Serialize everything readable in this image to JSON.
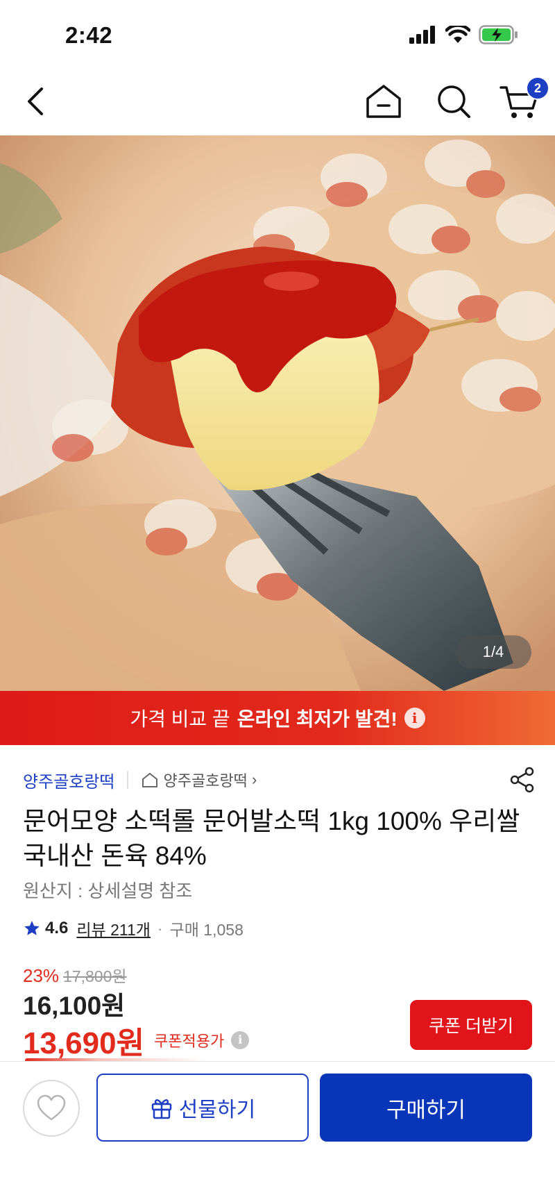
{
  "status_bar": {
    "time": "2:42",
    "icons": [
      "signal-icon",
      "wifi-icon",
      "battery-charging-icon"
    ]
  },
  "nav": {
    "icons": [
      "back-icon",
      "home-icon",
      "search-icon",
      "cart-icon"
    ],
    "cart_count": "2"
  },
  "product_image": {
    "counter": "1/4"
  },
  "promo_banner": {
    "text_regular": "가격 비교 끝",
    "text_bold": "온라인 최저가 발견!",
    "info_icon": "i"
  },
  "seller": {
    "name": "양주골호랑떡",
    "store_link": "양주골호랑떡",
    "store_chevron": "›"
  },
  "product": {
    "title": "문어모양 소떡롤 문어발소떡 1kg 100% 우리쌀 국내산 돈육 84%",
    "origin": "원산지 : 상세설명 참조"
  },
  "rating": {
    "score": "4.6",
    "review_label": "리뷰 211개",
    "separator": "·",
    "purchase": "구매 1,058"
  },
  "price": {
    "discount_rate": "23%",
    "original": "17,800원",
    "sale": "16,100원",
    "coupon_price": "13,690원",
    "coupon_label": "쿠폰적용가",
    "info_icon": "i",
    "coupon_button": "쿠폰 더받기"
  },
  "bottom_bar": {
    "gift_label": "선물하기",
    "buy_label": "구매하기"
  },
  "colors": {
    "brand_blue": "#1c3fc4",
    "buy_blue": "#0935b8",
    "accent_red": "#e22b1d",
    "coupon_red": "#e0141a"
  }
}
